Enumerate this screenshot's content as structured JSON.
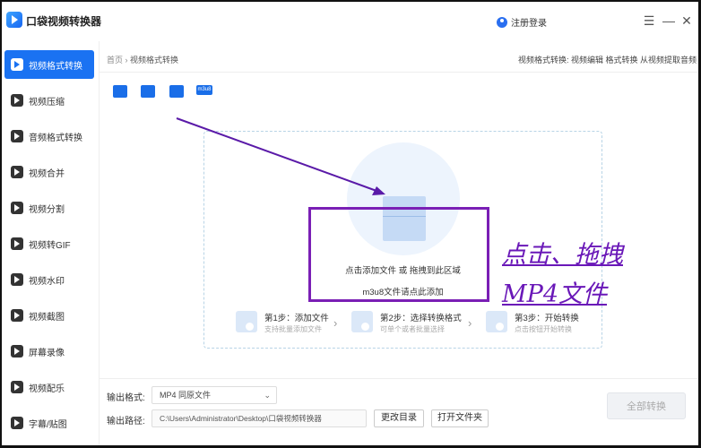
{
  "app": {
    "title": "口袋视频转换器",
    "login_label": "注册登录",
    "controls": [
      "☰",
      "—",
      "✕"
    ]
  },
  "sidebar": {
    "items": [
      {
        "label": "视频格式转换",
        "icon": "video-convert-icon",
        "active": true
      },
      {
        "label": "视频压缩",
        "icon": "video-compress-icon"
      },
      {
        "label": "音频格式转换",
        "icon": "audio-convert-icon"
      },
      {
        "label": "视频合并",
        "icon": "video-merge-icon"
      },
      {
        "label": "视频分割",
        "icon": "video-split-icon"
      },
      {
        "label": "视频转GIF",
        "icon": "gif-icon"
      },
      {
        "label": "视频水印",
        "icon": "watermark-icon"
      },
      {
        "label": "视频截图",
        "icon": "screenshot-icon"
      },
      {
        "label": "屏幕录像",
        "icon": "screen-record-icon"
      },
      {
        "label": "视频配乐",
        "icon": "music-icon"
      },
      {
        "label": "字幕/贴图",
        "icon": "subtitle-icon"
      }
    ]
  },
  "breadcrumb": {
    "home": "首页",
    "sep": "›",
    "current": "视频格式转换"
  },
  "quicklinks": "视频格式转换: 视频编辑 格式转换 从视频提取音频",
  "toolbar": {
    "m3u8": "m3u8"
  },
  "dropzone": {
    "line1": "点击添加文件 或 拖拽到此区域",
    "line2": "m3u8文件请点此添加"
  },
  "steps": [
    {
      "title": "第1步：添加文件",
      "desc": "支持批量添加文件"
    },
    {
      "title": "第2步：选择转换格式",
      "desc": "可单个或者批量选择"
    },
    {
      "title": "第3步：开始转换",
      "desc": "点击按钮开始转换"
    }
  ],
  "output": {
    "format_label": "输出格式:",
    "format_value": "MP4  同原文件",
    "path_label": "输出路径:",
    "path_value": "C:\\Users\\Administrator\\Desktop\\口袋视频转换器",
    "change_dir": "更改目录",
    "open_folder": "打开文件夹",
    "convert_all": "全部转换"
  },
  "annotation": {
    "line1": "点击、拖拽",
    "line2": "MP4文件",
    "color": "#6a18b8"
  }
}
